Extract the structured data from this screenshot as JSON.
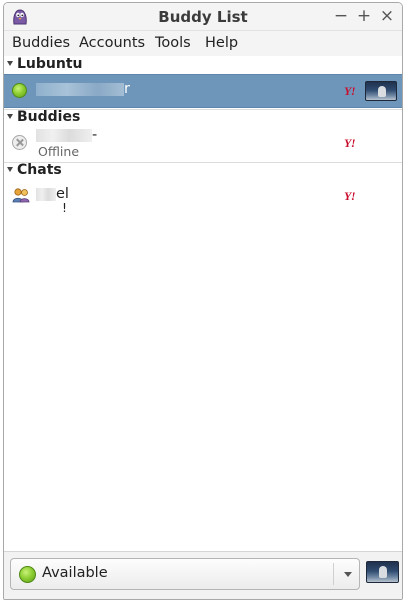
{
  "window": {
    "title": "Buddy List",
    "controls": {
      "minimize": "−",
      "maximize": "+",
      "close": "×"
    }
  },
  "menubar": {
    "items": [
      "Buddies",
      "Accounts",
      "Tools",
      "Help"
    ]
  },
  "groups": [
    {
      "label": "Lubuntu",
      "rows": [
        {
          "name_visible_suffix": "r",
          "status": "available",
          "protocol_icon": "yahoo-icon",
          "protocol_glyph": "Y!",
          "selected": true
        }
      ]
    },
    {
      "label": "Buddies",
      "rows": [
        {
          "name_visible_suffix": "-",
          "status_text": "Offline",
          "status": "offline",
          "protocol_icon": "yahoo-icon",
          "protocol_glyph": "Y!"
        }
      ]
    },
    {
      "label": "Chats",
      "rows": [
        {
          "name_visible_suffix": "el",
          "sub_mark": "!",
          "type": "chat",
          "protocol_icon": "yahoo-icon",
          "protocol_glyph": "Y!"
        }
      ]
    }
  ],
  "statusbar": {
    "selected_status": "Available"
  },
  "colors": {
    "selection": "#6e96bb",
    "available": "#8fcf34",
    "yahoo": "#c8102e"
  }
}
